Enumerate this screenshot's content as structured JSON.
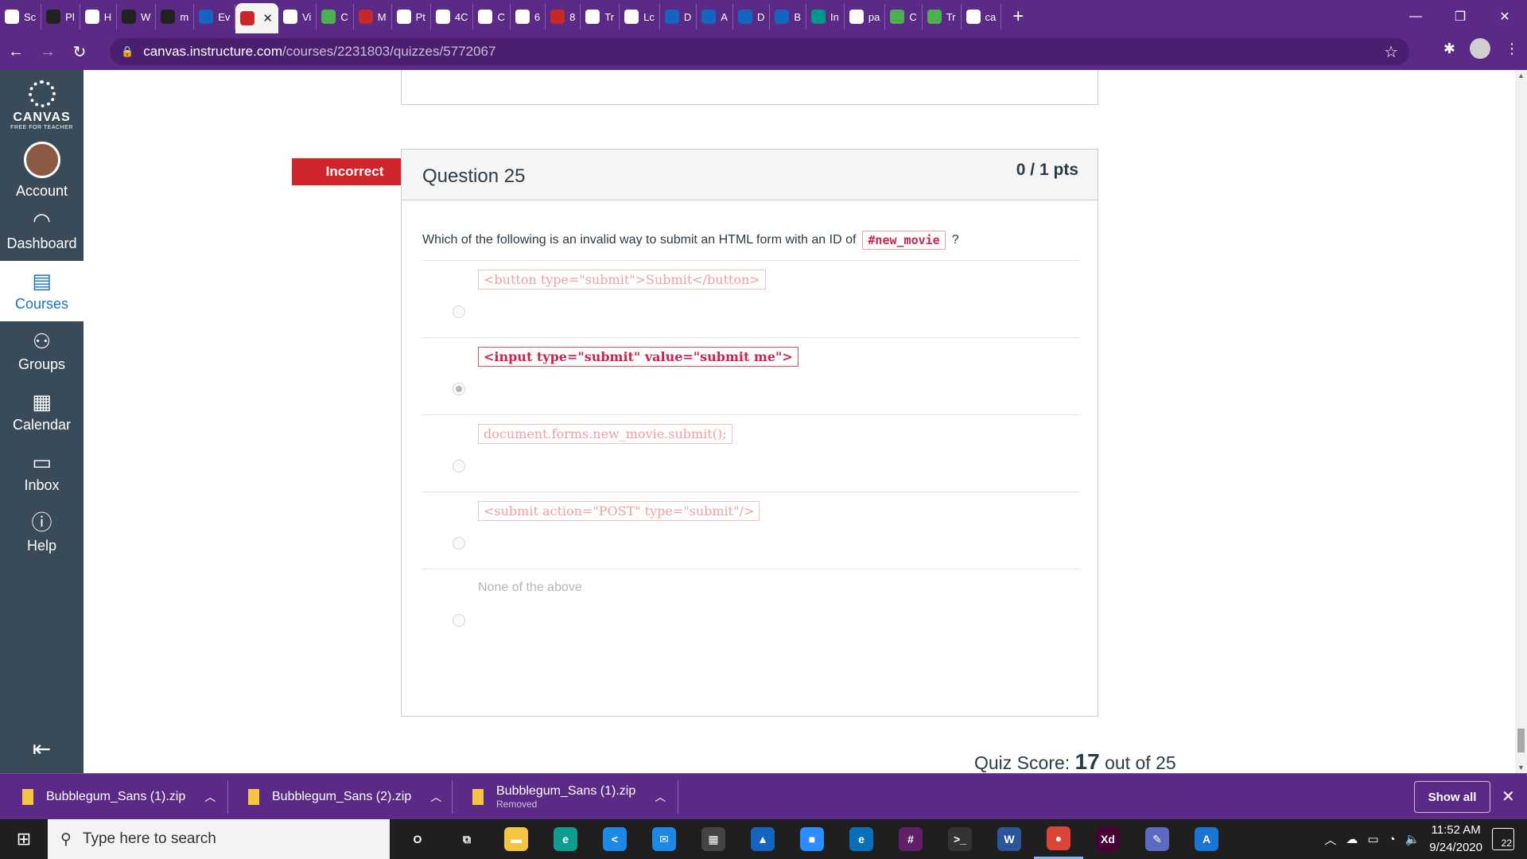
{
  "browser": {
    "tabs": [
      {
        "label": "Sc",
        "icon": "fav-icon",
        "style": ""
      },
      {
        "label": "Pl",
        "icon": "fav-icon",
        "style": "dark"
      },
      {
        "label": "H",
        "icon": "fav-icon",
        "style": ""
      },
      {
        "label": "W",
        "icon": "trello-icon",
        "style": "dark"
      },
      {
        "label": "m",
        "icon": "github-icon",
        "style": "dark"
      },
      {
        "label": "Ev",
        "icon": "fav-icon",
        "style": "blue"
      },
      {
        "label": "Vi",
        "icon": "fav-icon",
        "style": ""
      },
      {
        "label": "C",
        "icon": "fav-icon",
        "style": "green"
      },
      {
        "label": "M",
        "icon": "fav-icon",
        "style": "red"
      },
      {
        "label": "Pt",
        "icon": "fav-icon",
        "style": ""
      },
      {
        "label": "4C",
        "icon": "fav-icon",
        "style": ""
      },
      {
        "label": "C",
        "icon": "fav-icon",
        "style": ""
      },
      {
        "label": "6",
        "icon": "fav-icon",
        "style": ""
      },
      {
        "label": "8",
        "icon": "fav-icon",
        "style": "red"
      },
      {
        "label": "Tr",
        "icon": "code-icon",
        "style": ""
      },
      {
        "label": "Lc",
        "icon": "fav-icon",
        "style": ""
      },
      {
        "label": "D",
        "icon": "fav-icon",
        "style": "blue"
      },
      {
        "label": "A",
        "icon": "fav-icon",
        "style": "blue"
      },
      {
        "label": "D",
        "icon": "fav-icon",
        "style": "blue"
      },
      {
        "label": "B",
        "icon": "fav-icon",
        "style": "blue"
      },
      {
        "label": "In",
        "icon": "fav-icon",
        "style": "teal"
      },
      {
        "label": "pa",
        "icon": "google-icon",
        "style": ""
      },
      {
        "label": "C",
        "icon": "fav-icon",
        "style": "green"
      },
      {
        "label": "Tr",
        "icon": "fav-icon",
        "style": "green"
      },
      {
        "label": "ca",
        "icon": "google-icon",
        "style": ""
      }
    ],
    "url_host": "canvas.instructure.com",
    "url_path": "/courses/2231803/quizzes/5772067"
  },
  "nav": {
    "logo_word": "CANVAS",
    "logo_sub": "FREE FOR TEACHER",
    "items": [
      {
        "label": "Account",
        "icon": "account-avatar-icon"
      },
      {
        "label": "Dashboard",
        "icon": "dashboard-icon"
      },
      {
        "label": "Courses",
        "icon": "courses-icon"
      },
      {
        "label": "Groups",
        "icon": "groups-icon"
      },
      {
        "label": "Calendar",
        "icon": "calendar-icon"
      },
      {
        "label": "Inbox",
        "icon": "inbox-icon"
      },
      {
        "label": "Help",
        "icon": "help-icon"
      }
    ]
  },
  "question": {
    "status": "Incorrect",
    "title": "Question 25",
    "points": "0 / 1 pts",
    "text_before": "Which of the following is an invalid way to submit an HTML form with an ID of",
    "text_code": "#new_movie",
    "text_after": "?",
    "answers": [
      {
        "text": "<button type=\"submit\">Submit</button>",
        "kind": "code",
        "selected": false
      },
      {
        "text": "<input type=\"submit\" value=\"submit me\">",
        "kind": "code",
        "selected": true
      },
      {
        "text": "document.forms.new_movie.submit();",
        "kind": "code",
        "selected": false
      },
      {
        "text": "<submit action=\"POST\" type=\"submit\"/>",
        "kind": "code",
        "selected": false
      },
      {
        "text": "None of the above",
        "kind": "plain",
        "selected": false
      }
    ]
  },
  "quiz_score": {
    "label": "Quiz Score:",
    "score": "17",
    "suffix": "out of 25"
  },
  "downloads": [
    {
      "name": "Bubblegum_Sans (1).zip",
      "status": ""
    },
    {
      "name": "Bubblegum_Sans (2).zip",
      "status": ""
    },
    {
      "name": "Bubblegum_Sans (1).zip",
      "status": "Removed"
    }
  ],
  "download_bar": {
    "show_all": "Show all"
  },
  "taskbar": {
    "search_placeholder": "Type here to search",
    "time": "11:52 AM",
    "date": "9/24/2020",
    "notifications": "22",
    "apps": [
      {
        "name": "cortana-icon",
        "glyph": "O",
        "color": "transparent"
      },
      {
        "name": "task-view-icon",
        "glyph": "⧉",
        "color": "transparent"
      },
      {
        "name": "file-explorer-icon",
        "glyph": "▬",
        "color": "#f4c542"
      },
      {
        "name": "edge-icon",
        "glyph": "e",
        "color": "#0f9d8f"
      },
      {
        "name": "vscode-icon",
        "glyph": "<",
        "color": "#1e88e5"
      },
      {
        "name": "mail-icon",
        "glyph": "✉",
        "color": "#1e88e5"
      },
      {
        "name": "store-icon",
        "glyph": "▦",
        "color": "#444"
      },
      {
        "name": "photos-icon",
        "glyph": "▲",
        "color": "#1565c0"
      },
      {
        "name": "zoom-icon",
        "glyph": "■",
        "color": "#2d8cff"
      },
      {
        "name": "edge-beta-icon",
        "glyph": "e",
        "color": "#0b6fb8"
      },
      {
        "name": "slack-icon",
        "glyph": "#",
        "color": "#611f69"
      },
      {
        "name": "terminal-icon",
        "glyph": ">_",
        "color": "#333"
      },
      {
        "name": "word-icon",
        "glyph": "W",
        "color": "#2b579a"
      },
      {
        "name": "chrome-icon",
        "glyph": "●",
        "color": "#db4437"
      },
      {
        "name": "xd-icon",
        "glyph": "Xd",
        "color": "#470137"
      },
      {
        "name": "paint-icon",
        "glyph": "✎",
        "color": "#5c6bc0"
      },
      {
        "name": "affinity-icon",
        "glyph": "A",
        "color": "#1976d2"
      }
    ]
  }
}
